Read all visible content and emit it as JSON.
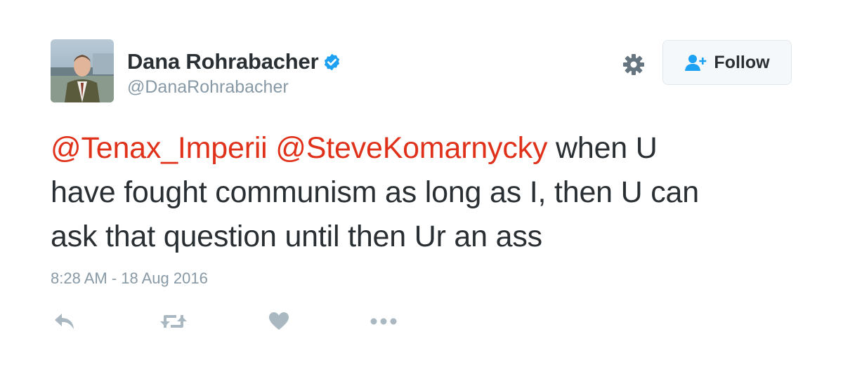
{
  "author": {
    "display_name": "Dana Rohrabacher",
    "handle": "@DanaRohrabacher",
    "verified": true,
    "avatar_icon": "profile-photo"
  },
  "header_actions": {
    "settings_icon": "gear-icon",
    "follow_label": "Follow",
    "follow_icon": "add-user-icon"
  },
  "tweet": {
    "mention_1": "@Tenax_Imperii",
    "mention_2": "@SteveKomarnycky",
    "text_line_1_rest": "when U",
    "text_line_2": "have fought communism as long as I, then U can",
    "text_line_3": "ask that question until then Ur an ass",
    "timestamp": "8:28 AM - 18 Aug 2016"
  },
  "actions": [
    {
      "name": "reply",
      "icon": "reply-icon"
    },
    {
      "name": "retweet",
      "icon": "retweet-icon"
    },
    {
      "name": "like",
      "icon": "heart-icon"
    },
    {
      "name": "more",
      "icon": "more-icon"
    }
  ],
  "colors": {
    "mention": "#e0311a",
    "muted": "#8899a6",
    "text": "#292f33",
    "verified": "#1da1f2",
    "follow_icon": "#1da1f2",
    "action_icon": "#aab8c2"
  }
}
